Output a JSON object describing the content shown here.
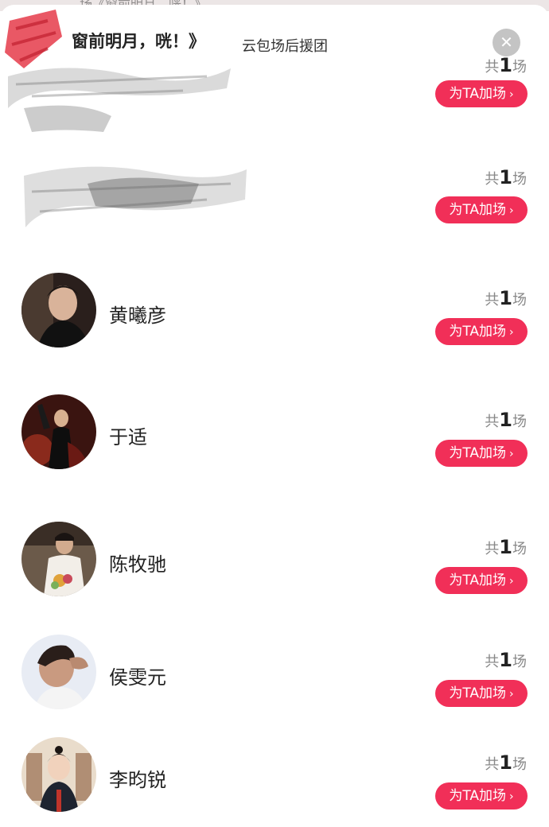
{
  "background_strip": {
    "text": "场《窗前明月，咣！》",
    "right_text": ""
  },
  "header": {
    "title": "窗前明月，咣！》",
    "subtitle": "云包场后援团",
    "close_icon": "close-icon"
  },
  "rows": [
    {
      "name": "",
      "count_prefix": "共",
      "count_num": "1",
      "count_suffix": "场",
      "button_label": "为TA加场"
    },
    {
      "name": "",
      "count_prefix": "共",
      "count_num": "1",
      "count_suffix": "场",
      "button_label": "为TA加场"
    },
    {
      "name": "黄曦彦",
      "count_prefix": "共",
      "count_num": "1",
      "count_suffix": "场",
      "button_label": "为TA加场"
    },
    {
      "name": "于适",
      "count_prefix": "共",
      "count_num": "1",
      "count_suffix": "场",
      "button_label": "为TA加场"
    },
    {
      "name": "陈牧驰",
      "count_prefix": "共",
      "count_num": "1",
      "count_suffix": "场",
      "button_label": "为TA加场"
    },
    {
      "name": "侯雯元",
      "count_prefix": "共",
      "count_num": "1",
      "count_suffix": "场",
      "button_label": "为TA加场"
    },
    {
      "name": "李昀锐",
      "count_prefix": "共",
      "count_num": "1",
      "count_suffix": "场",
      "button_label": "为TA加场"
    }
  ],
  "colors": {
    "accent": "#f12f58",
    "close_bg": "#c4c4c4"
  }
}
